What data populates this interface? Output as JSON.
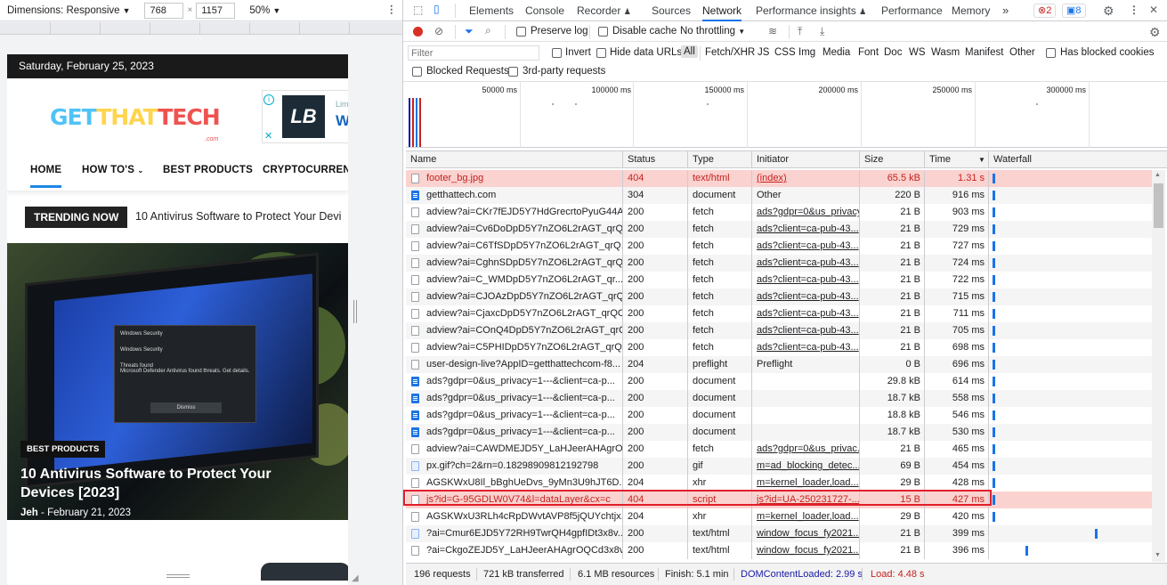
{
  "device": {
    "dimensions_label": "Dimensions: Responsive",
    "width": "768",
    "height": "1157",
    "zoom": "50%"
  },
  "site": {
    "date": "Saturday, February 25, 2023",
    "logo_part1": "GET",
    "logo_part2": "THAT",
    "logo_part3": "TECH",
    "logo_sub": ".com",
    "ad_line1": "Lim",
    "ad_line2": "W",
    "nav": [
      "HOME",
      "HOW TO'S",
      "BEST PRODUCTS",
      "CRYPTOCURRENC"
    ],
    "trending_label": "TRENDING NOW",
    "trending_text": "10 Antivirus Software to Protect Your Devi",
    "hero_badge": "BEST PRODUCTS",
    "hero_title": "10 Antivirus Software to Protect Your Devices [2023]",
    "hero_author": "Jeh",
    "hero_date": "February 21, 2023",
    "dialog_title": "Windows Security",
    "dialog_line1": "Windows Security",
    "dialog_line2": "Threats found",
    "dialog_line3": "Microsoft Defender Antivirus found threats. Get details.",
    "dialog_button": "Dismiss"
  },
  "devtools": {
    "tabs": [
      "Elements",
      "Console",
      "Recorder",
      "Sources",
      "Network",
      "Performance insights",
      "Performance",
      "Memory"
    ],
    "more_tabs": "»",
    "errors_count": "2",
    "messages_count": "8",
    "preserve_log": "Preserve log",
    "disable_cache": "Disable cache",
    "throttling": "No throttling",
    "filter_placeholder": "Filter",
    "invert": "Invert",
    "hide_data_urls": "Hide data URLs",
    "types": [
      "All",
      "Fetch/XHR",
      "JS",
      "CSS",
      "Img",
      "Media",
      "Font",
      "Doc",
      "WS",
      "Wasm",
      "Manifest",
      "Other"
    ],
    "has_blocked_cookies": "Has blocked cookies",
    "blocked_requests": "Blocked Requests",
    "third_party": "3rd-party requests",
    "timeline_labels": [
      "50000 ms",
      "100000 ms",
      "150000 ms",
      "200000 ms",
      "250000 ms",
      "300000 ms"
    ],
    "columns": [
      "Name",
      "Status",
      "Type",
      "Initiator",
      "Size",
      "Time",
      "Waterfall"
    ],
    "rows": [
      {
        "name": "footer_bg.jpg",
        "status": "404",
        "type": "text/html",
        "initiator": "(index)",
        "size": "65.5 kB",
        "time": "1.31 s",
        "icon": "file",
        "error": true,
        "link": true,
        "wf": 0.0
      },
      {
        "name": "getthattech.com",
        "status": "304",
        "type": "document",
        "initiator": "Other",
        "size": "220 B",
        "time": "916 ms",
        "icon": "doc",
        "error": false,
        "link": false,
        "wf": 0.0
      },
      {
        "name": "adview?ai=CKr7fEJD5Y7HdGrecrtoPyuG44A...",
        "status": "200",
        "type": "fetch",
        "initiator": "ads?gdpr=0&us_privacy...",
        "size": "21 B",
        "time": "903 ms",
        "icon": "file",
        "error": false,
        "link": true,
        "wf": 0.0
      },
      {
        "name": "adview?ai=Cv6DoDpD5Y7nZO6L2rAGT_qrQ...",
        "status": "200",
        "type": "fetch",
        "initiator": "ads?client=ca-pub-43...",
        "size": "21 B",
        "time": "729 ms",
        "icon": "file",
        "error": false,
        "link": true,
        "wf": 0.0
      },
      {
        "name": "adview?ai=C6TfSDpD5Y7nZO6L2rAGT_qrQ...",
        "status": "200",
        "type": "fetch",
        "initiator": "ads?client=ca-pub-43...",
        "size": "21 B",
        "time": "727 ms",
        "icon": "file",
        "error": false,
        "link": true,
        "wf": 0.0
      },
      {
        "name": "adview?ai=CghnSDpD5Y7nZO6L2rAGT_qrQ...",
        "status": "200",
        "type": "fetch",
        "initiator": "ads?client=ca-pub-43...",
        "size": "21 B",
        "time": "724 ms",
        "icon": "file",
        "error": false,
        "link": true,
        "wf": 0.0
      },
      {
        "name": "adview?ai=C_WMDpD5Y7nZO6L2rAGT_qr...",
        "status": "200",
        "type": "fetch",
        "initiator": "ads?client=ca-pub-43...",
        "size": "21 B",
        "time": "722 ms",
        "icon": "file",
        "error": false,
        "link": true,
        "wf": 0.0
      },
      {
        "name": "adview?ai=CJOAzDpD5Y7nZO6L2rAGT_qrQ...",
        "status": "200",
        "type": "fetch",
        "initiator": "ads?client=ca-pub-43...",
        "size": "21 B",
        "time": "715 ms",
        "icon": "file",
        "error": false,
        "link": true,
        "wf": 0.0
      },
      {
        "name": "adview?ai=CjaxcDpD5Y7nZO6L2rAGT_qrQC...",
        "status": "200",
        "type": "fetch",
        "initiator": "ads?client=ca-pub-43...",
        "size": "21 B",
        "time": "711 ms",
        "icon": "file",
        "error": false,
        "link": true,
        "wf": 0.0
      },
      {
        "name": "adview?ai=COnQ4DpD5Y7nZO6L2rAGT_qrQ...",
        "status": "200",
        "type": "fetch",
        "initiator": "ads?client=ca-pub-43...",
        "size": "21 B",
        "time": "705 ms",
        "icon": "file",
        "error": false,
        "link": true,
        "wf": 0.0
      },
      {
        "name": "adview?ai=C5PHIDpD5Y7nZO6L2rAGT_qrQ...",
        "status": "200",
        "type": "fetch",
        "initiator": "ads?client=ca-pub-43...",
        "size": "21 B",
        "time": "698 ms",
        "icon": "file",
        "error": false,
        "link": true,
        "wf": 0.0
      },
      {
        "name": "user-design-live?AppID=getthattechcom-f8...",
        "status": "204",
        "type": "preflight",
        "initiator": "Preflight",
        "size": "0 B",
        "time": "696 ms",
        "icon": "file",
        "error": false,
        "link": false,
        "wf": 0.0
      },
      {
        "name": "ads?gdpr=0&us_privacy=1---&client=ca-p...",
        "status": "200",
        "type": "document",
        "initiator": "",
        "size": "29.8 kB",
        "time": "614 ms",
        "icon": "doc",
        "error": false,
        "link": false,
        "wf": 0.0
      },
      {
        "name": "ads?gdpr=0&us_privacy=1---&client=ca-p...",
        "status": "200",
        "type": "document",
        "initiator": "",
        "size": "18.7 kB",
        "time": "558 ms",
        "icon": "doc",
        "error": false,
        "link": false,
        "wf": 0.0
      },
      {
        "name": "ads?gdpr=0&us_privacy=1---&client=ca-p...",
        "status": "200",
        "type": "document",
        "initiator": "",
        "size": "18.8 kB",
        "time": "546 ms",
        "icon": "doc",
        "error": false,
        "link": false,
        "wf": 0.0
      },
      {
        "name": "ads?gdpr=0&us_privacy=1---&client=ca-p...",
        "status": "200",
        "type": "document",
        "initiator": "",
        "size": "18.7 kB",
        "time": "530 ms",
        "icon": "doc",
        "error": false,
        "link": false,
        "wf": 0.0
      },
      {
        "name": "adview?ai=CAWDMEJD5Y_LaHJeerAHAgrO...",
        "status": "200",
        "type": "fetch",
        "initiator": "ads?gdpr=0&us_privac...",
        "size": "21 B",
        "time": "465 ms",
        "icon": "file",
        "error": false,
        "link": true,
        "wf": 0.0
      },
      {
        "name": "px.gif?ch=2&rn=0.18298909812192798",
        "status": "200",
        "type": "gif",
        "initiator": "m=ad_blocking_detec...",
        "size": "69 B",
        "time": "454 ms",
        "icon": "img",
        "error": false,
        "link": true,
        "wf": 0.0
      },
      {
        "name": "AGSKWxU8Il_bBghUeDvs_9yMn3U9hJT6D...",
        "status": "204",
        "type": "xhr",
        "initiator": "m=kernel_loader,load...",
        "size": "29 B",
        "time": "428 ms",
        "icon": "file",
        "error": false,
        "link": true,
        "wf": 0.0
      },
      {
        "name": "js?id=G-95GDLW0V74&l=dataLayer&cx=c",
        "status": "404",
        "type": "script",
        "initiator": "js?id=UA-250231727-...",
        "size": "15 B",
        "time": "427 ms",
        "icon": "file",
        "error": true,
        "link": true,
        "wf": 0.0
      },
      {
        "name": "AGSKWxU3RLh4cRpDWvtAVP8f5jQUYchtjx...",
        "status": "204",
        "type": "xhr",
        "initiator": "m=kernel_loader,load...",
        "size": "29 B",
        "time": "420 ms",
        "icon": "file",
        "error": false,
        "link": true,
        "wf": 0.0
      },
      {
        "name": "?ai=Cmur6EJD5Y72RH9TwrQH4gpfIDt3x8v...",
        "status": "200",
        "type": "text/html",
        "initiator": "window_focus_fy2021...",
        "size": "21 B",
        "time": "399 ms",
        "icon": "img",
        "error": false,
        "link": true,
        "wf": 0.63
      },
      {
        "name": "?ai=CkgoZEJD5Y_LaHJeerAHAgrOQCd3x8v...",
        "status": "200",
        "type": "text/html",
        "initiator": "window_focus_fy2021...",
        "size": "21 B",
        "time": "396 ms",
        "icon": "file",
        "error": false,
        "link": true,
        "wf": 0.2
      }
    ],
    "status": {
      "requests": "196 requests",
      "transferred": "721 kB transferred",
      "resources": "6.1 MB resources",
      "finish": "Finish: 5.1 min",
      "dcl": "DOMContentLoaded: 2.99 s",
      "load": "Load: 4.48 s"
    },
    "colors": {
      "accent": "#1a73e8",
      "error_row": "#fad2cf",
      "error_text": "#c5221f",
      "highlight_box": "#e01f2b",
      "dcl": "#1a1aa6",
      "load": "#c5221f"
    }
  }
}
